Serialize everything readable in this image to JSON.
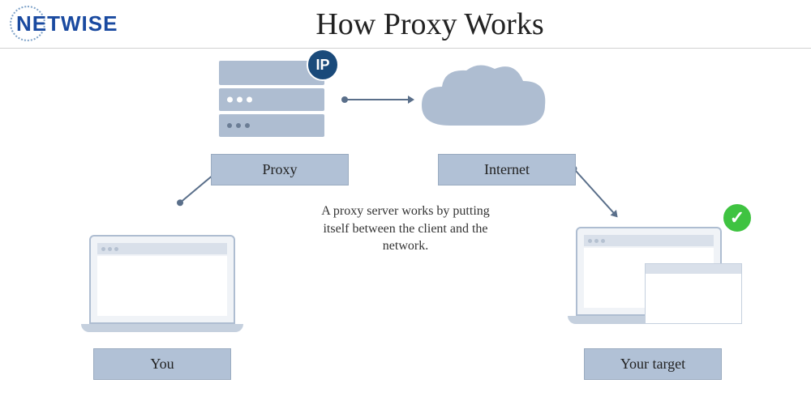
{
  "brand": {
    "name": "NETWISE"
  },
  "title": "How Proxy Works",
  "nodes": {
    "proxy": "Proxy",
    "internet": "Internet",
    "you": "You",
    "target": "Your target"
  },
  "badges": {
    "ip": "IP",
    "check": "✓"
  },
  "description": "A proxy server works by putting itself between the client and the network."
}
